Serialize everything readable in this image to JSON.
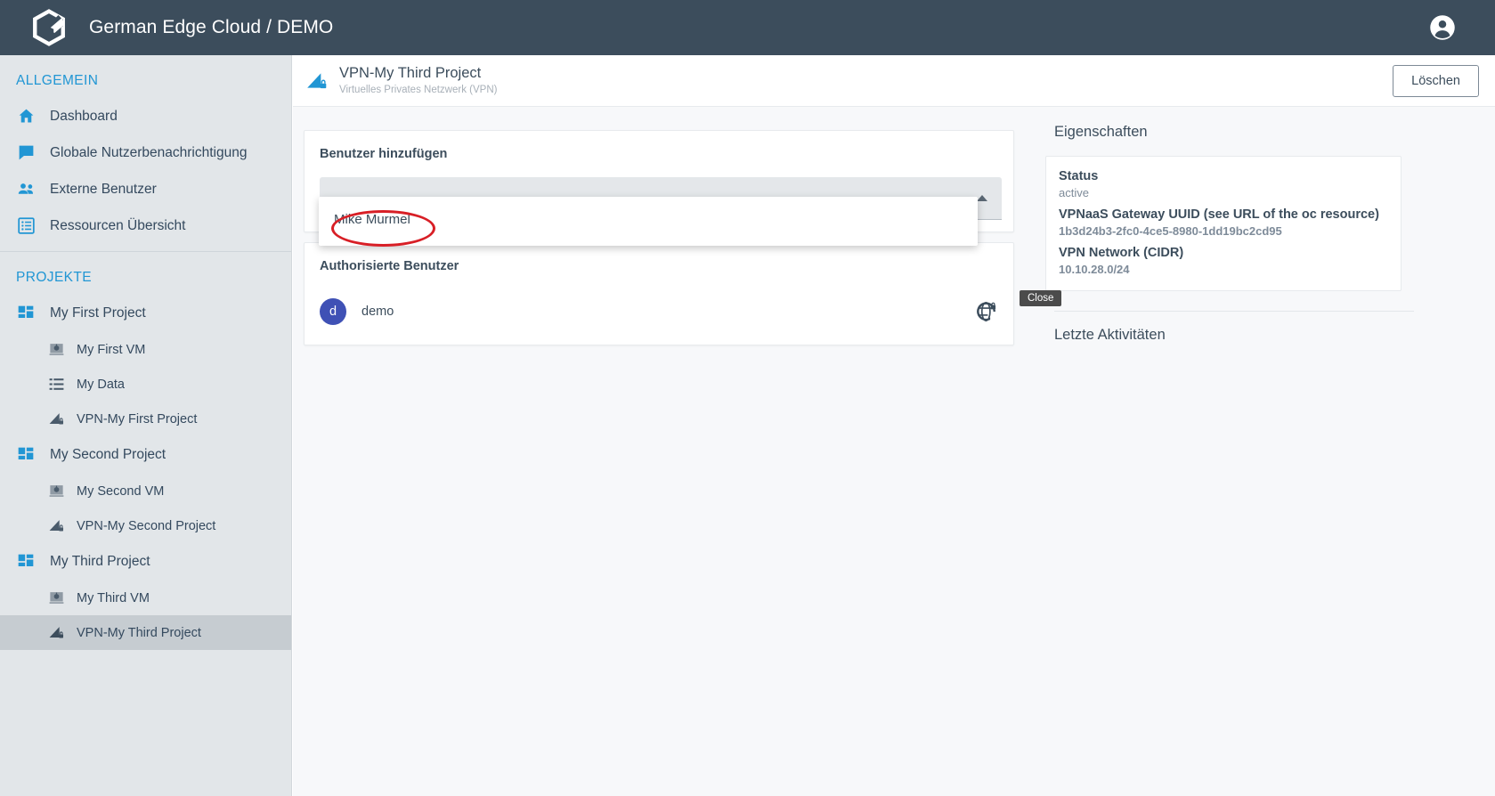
{
  "topbar": {
    "logo_icon": "gec-hexagon-logo",
    "title": "German Edge Cloud / DEMO",
    "account_icon": "account-circle-icon"
  },
  "sidebar": {
    "sections": [
      {
        "title": "ALLGEMEIN",
        "items": [
          {
            "label": "Dashboard",
            "icon": "home-icon"
          },
          {
            "label": "Globale Nutzerbenachrichtigung",
            "icon": "chat-bubble-icon"
          },
          {
            "label": "Externe Benutzer",
            "icon": "people-icon"
          },
          {
            "label": "Ressourcen Übersicht",
            "icon": "list-box-icon"
          }
        ]
      },
      {
        "title": "PROJEKTE",
        "projects": [
          {
            "label": "My First Project",
            "icon": "dashboard-grid-icon",
            "children": [
              {
                "label": "My First VM",
                "icon": "vm-icon",
                "selected": false
              },
              {
                "label": "My Data",
                "icon": "storage-list-icon",
                "selected": false
              },
              {
                "label": "VPN-My First Project",
                "icon": "vpn-lock-icon",
                "selected": false
              }
            ]
          },
          {
            "label": "My Second Project",
            "icon": "dashboard-grid-icon",
            "children": [
              {
                "label": "My Second VM",
                "icon": "vm-icon",
                "selected": false
              },
              {
                "label": "VPN-My Second Project",
                "icon": "vpn-lock-icon",
                "selected": false
              }
            ]
          },
          {
            "label": "My Third Project",
            "icon": "dashboard-grid-icon",
            "children": [
              {
                "label": "My Third VM",
                "icon": "vm-icon",
                "selected": false
              },
              {
                "label": "VPN-My Third Project",
                "icon": "vpn-lock-icon",
                "selected": true
              }
            ]
          }
        ]
      }
    ]
  },
  "page_header": {
    "icon": "vpn-lock-icon",
    "title": "VPN-My Third Project",
    "subtitle": "Virtuelles Privates Netzwerk (VPN)",
    "delete_button": "Löschen"
  },
  "add_user_card": {
    "label": "Benutzer hinzufügen",
    "select_value": "",
    "select_placeholder": "",
    "arrow_icon": "chevron-up-icon",
    "dropdown_open": true,
    "options": [
      "Mike Murmel"
    ]
  },
  "authorized_users_card": {
    "label": "Authorisierte Benutzer",
    "rows": [
      {
        "initial": "d",
        "name": "demo",
        "action_icon": "globe-lock-icon"
      }
    ]
  },
  "properties": {
    "title": "Eigenschaften",
    "entries": [
      {
        "key": "Status",
        "value": "active"
      },
      {
        "key": "VPNaaS Gateway UUID (see URL of the oc resource)",
        "value": "1b3d24b3-2fc0-4ce5-8980-1dd19bc2cd95"
      },
      {
        "key": "VPN Network (CIDR)",
        "value": "10.10.28.0/24"
      }
    ],
    "activities_title": "Letzte Aktivitäten"
  },
  "annotations": {
    "tooltip_text": "Close",
    "highlight_color": "#d81f26",
    "highlight_target": "Mike Murmel"
  },
  "colors": {
    "topbar": "#3c4d5c",
    "sidebar": "#e2e6e9",
    "accent_blue": "#2196d4",
    "avatar": "#3f51b5",
    "annotation_red": "#d81f26"
  }
}
